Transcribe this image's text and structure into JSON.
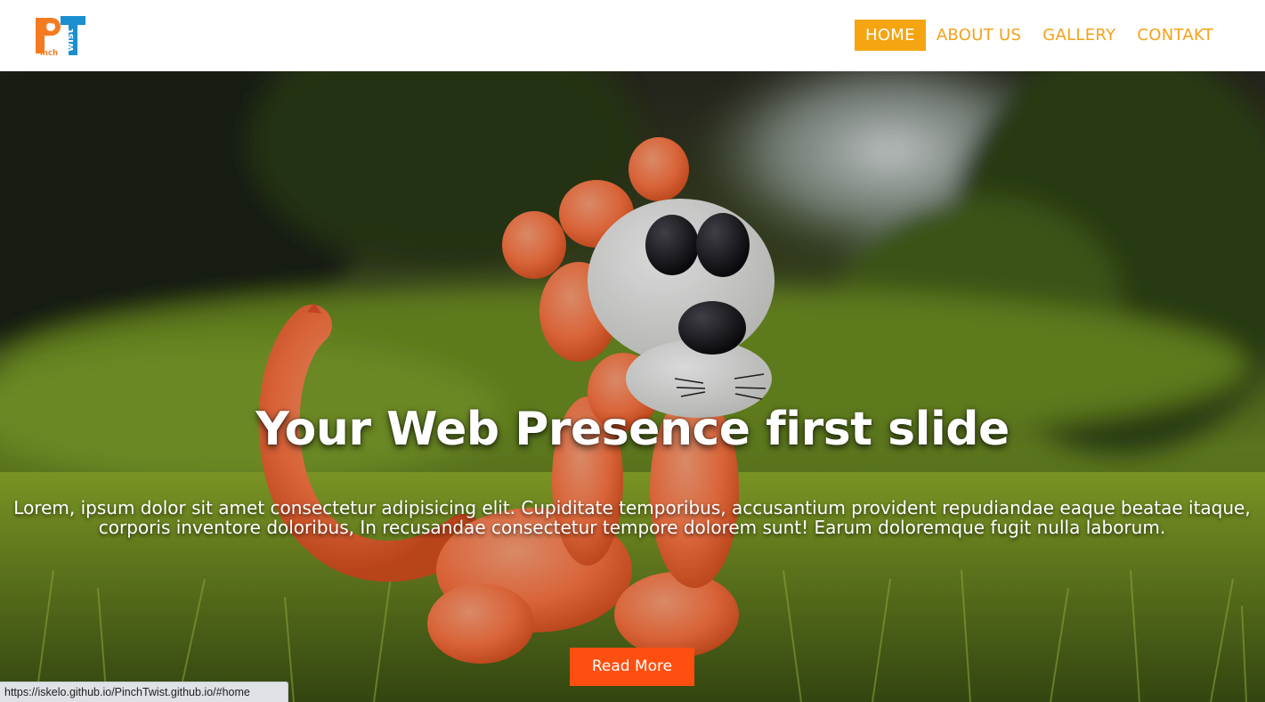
{
  "logo": {
    "alt": "PinchTwist",
    "letters_main": "PT",
    "letters_small_1": "inch",
    "letters_small_2": "wist"
  },
  "nav": {
    "items": [
      {
        "label": "HOME",
        "active": true
      },
      {
        "label": "ABOUT US",
        "active": false
      },
      {
        "label": "GALLERY",
        "active": false
      },
      {
        "label": "CONTAKT",
        "active": false
      }
    ]
  },
  "hero": {
    "title": "Your Web Presence first slide",
    "text": "Lorem, ipsum dolor sit amet consectetur adipisicing elit. Cupiditate temporibus, accusantium provident repudiandae eaque beatae itaque, corporis inventore doloribus, In recusandae consectetur tempore dolorem sunt! Earum doloremque fugit nulla laborum.",
    "button_label": "Read More",
    "image_subject": "balloon-lion-in-grass"
  },
  "statusbar": {
    "url": "https://iskelo.github.io/PinchTwist.github.io/#home"
  },
  "colors": {
    "accent": "#f5a511",
    "button": "#ff4f10",
    "logo_orange": "#f47b20",
    "logo_blue": "#1a8fd1"
  }
}
